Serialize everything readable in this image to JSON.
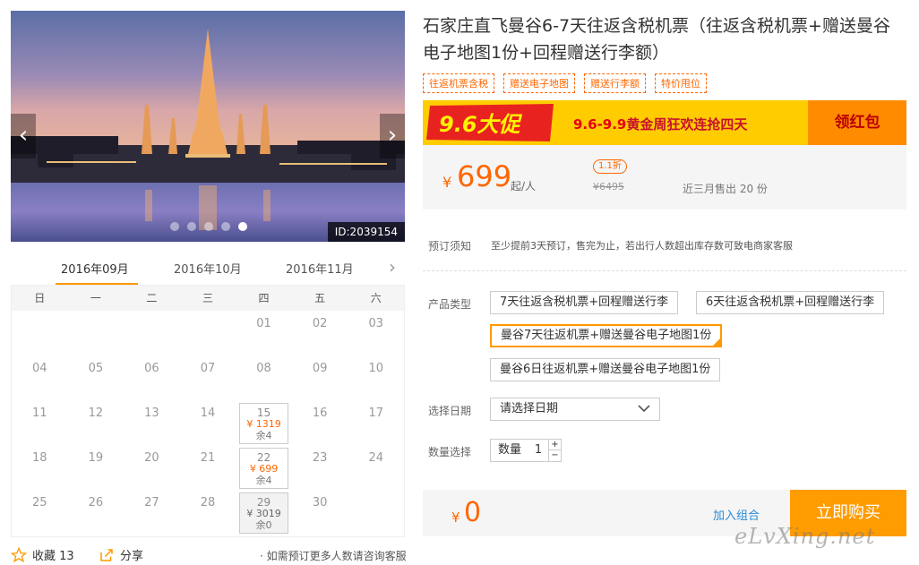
{
  "gallery": {
    "prev_label": "‹",
    "next_label": "›",
    "image_id": "ID:2039154",
    "slide_count": 5,
    "active_slide": 5
  },
  "calendar": {
    "months": [
      "2016年09月",
      "2016年10月",
      "2016年11月"
    ],
    "next_label": "›",
    "weekdays": [
      "日",
      "一",
      "二",
      "三",
      "四",
      "五",
      "六"
    ],
    "days": [
      {
        "d": ""
      },
      {
        "d": ""
      },
      {
        "d": ""
      },
      {
        "d": ""
      },
      {
        "d": "01"
      },
      {
        "d": "02"
      },
      {
        "d": "03"
      },
      {
        "d": "04"
      },
      {
        "d": "05"
      },
      {
        "d": "06"
      },
      {
        "d": "07"
      },
      {
        "d": "08"
      },
      {
        "d": "09"
      },
      {
        "d": "10"
      },
      {
        "d": "11"
      },
      {
        "d": "12"
      },
      {
        "d": "13"
      },
      {
        "d": "14"
      },
      {
        "d": "15",
        "price": "¥ 1319",
        "stock": "余4"
      },
      {
        "d": "16"
      },
      {
        "d": "17"
      },
      {
        "d": "18"
      },
      {
        "d": "19"
      },
      {
        "d": "20"
      },
      {
        "d": "21"
      },
      {
        "d": "22",
        "price": "¥ 699",
        "stock": "余4"
      },
      {
        "d": "23"
      },
      {
        "d": "24"
      },
      {
        "d": "25"
      },
      {
        "d": "26"
      },
      {
        "d": "27"
      },
      {
        "d": "28"
      },
      {
        "d": "29",
        "price": "¥ 3019",
        "stock": "余0",
        "soldout": true
      },
      {
        "d": "30"
      },
      {
        "d": ""
      }
    ]
  },
  "footer_left": {
    "fav_label": "收藏 13",
    "share_label": "分享",
    "consult_text": "· 如需预订更多人数请咨询客服"
  },
  "product": {
    "title": "石家庄直飞曼谷6-7天往返含税机票（往返含税机票+赠送曼谷电子地图1份+回程赠送行李额）",
    "tags": [
      "往返机票含税",
      "赠送电子地图",
      "赠送行李额",
      "特价甩位"
    ]
  },
  "promo": {
    "logo_text": "9.6大促",
    "text_dates": "9.6-9.9",
    "text_rest": "黄金周狂欢连抢四天",
    "button": "领红包"
  },
  "price": {
    "currency": "¥",
    "value": "699",
    "unit": "起/人",
    "discount": "1.1折",
    "original": "¥6495",
    "sold": "近三月售出 20 份"
  },
  "booking": {
    "notice_label": "预订须知",
    "notice_text": "至少提前3天预订，售完为止，若出行人数超出库存数可致电商家客服",
    "type_label": "产品类型",
    "options": [
      "7天往返含税机票+回程赠送行李",
      "6天往返含税机票+回程赠送行李",
      "曼谷7天往返机票+赠送曼谷电子地图1份",
      "曼谷6日往返机票+赠送曼谷电子地图1份"
    ],
    "selected_option": 2,
    "date_label": "选择日期",
    "date_placeholder": "请选择日期",
    "qty_label_row": "数量选择",
    "qty_label": "数量",
    "qty_value": "1",
    "qty_plus": "+",
    "qty_minus": "−"
  },
  "purchase": {
    "currency": "¥",
    "total": "0",
    "add_combo": "加入组合",
    "buy_now": "立即购买"
  },
  "watermark": "eLvXing.net",
  "colors": {
    "accent": "#ff9c00",
    "price": "#ff6600",
    "promo_bg": "#ffcc00",
    "link": "#2a8bd8"
  }
}
